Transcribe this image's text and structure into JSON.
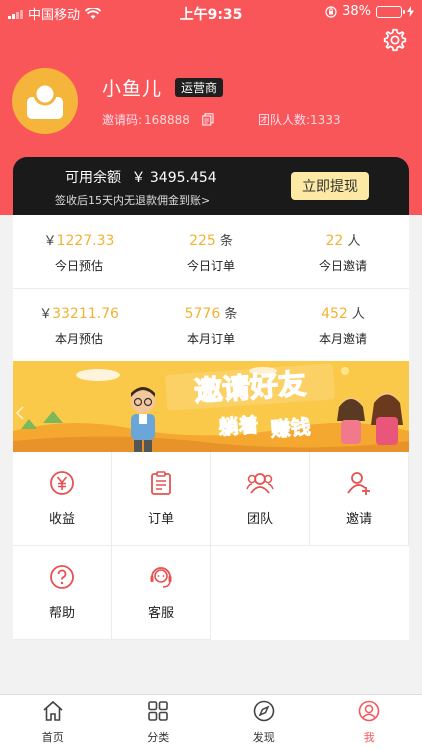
{
  "status_bar": {
    "carrier": "中国移动",
    "time": "上午9:35",
    "battery_percent": "38%",
    "battery_level": 0.38
  },
  "profile": {
    "name": "小鱼儿",
    "badge": "运营商",
    "invite_label": "邀请码:",
    "invite_code": "168888",
    "team_label": "团队人数:",
    "team_count": "1333"
  },
  "balance": {
    "label": "可用余额",
    "amount": "￥ 3495.454",
    "note": "签收后15天内无退款佣金到账>",
    "withdraw_label": "立即提现"
  },
  "today": [
    {
      "prefix": "￥",
      "value": "1227.33",
      "suffix": "",
      "label": "今日预估"
    },
    {
      "prefix": "",
      "value": "225",
      "suffix": " 条",
      "label": "今日订单"
    },
    {
      "prefix": "",
      "value": "22",
      "suffix": " 人",
      "label": "今日邀请"
    }
  ],
  "month": [
    {
      "prefix": "￥",
      "value": "33211.76",
      "suffix": "",
      "label": "本月预估"
    },
    {
      "prefix": "",
      "value": "5776",
      "suffix": " 条",
      "label": "本月订单"
    },
    {
      "prefix": "",
      "value": "452",
      "suffix": " 人",
      "label": "本月邀请"
    }
  ],
  "banner": {
    "line1": "邀请好友",
    "line2a": "躺着",
    "line2b": "赚钱"
  },
  "menu": [
    {
      "label": "收益",
      "icon": "yen-circle-icon"
    },
    {
      "label": "订单",
      "icon": "clipboard-icon"
    },
    {
      "label": "团队",
      "icon": "team-icon"
    },
    {
      "label": "邀请",
      "icon": "add-user-icon"
    },
    {
      "label": "帮助",
      "icon": "help-icon"
    },
    {
      "label": "客服",
      "icon": "headset-icon"
    }
  ],
  "tabs": [
    {
      "label": "首页",
      "icon": "home-icon"
    },
    {
      "label": "分类",
      "icon": "grid-icon"
    },
    {
      "label": "发现",
      "icon": "compass-icon"
    },
    {
      "label": "我",
      "icon": "user-icon",
      "active": true
    }
  ],
  "colors": {
    "primary": "#f9565a",
    "accent_gold": "#f2b233",
    "card_dark": "#1a1a1a",
    "button_light": "#fce9a4"
  }
}
